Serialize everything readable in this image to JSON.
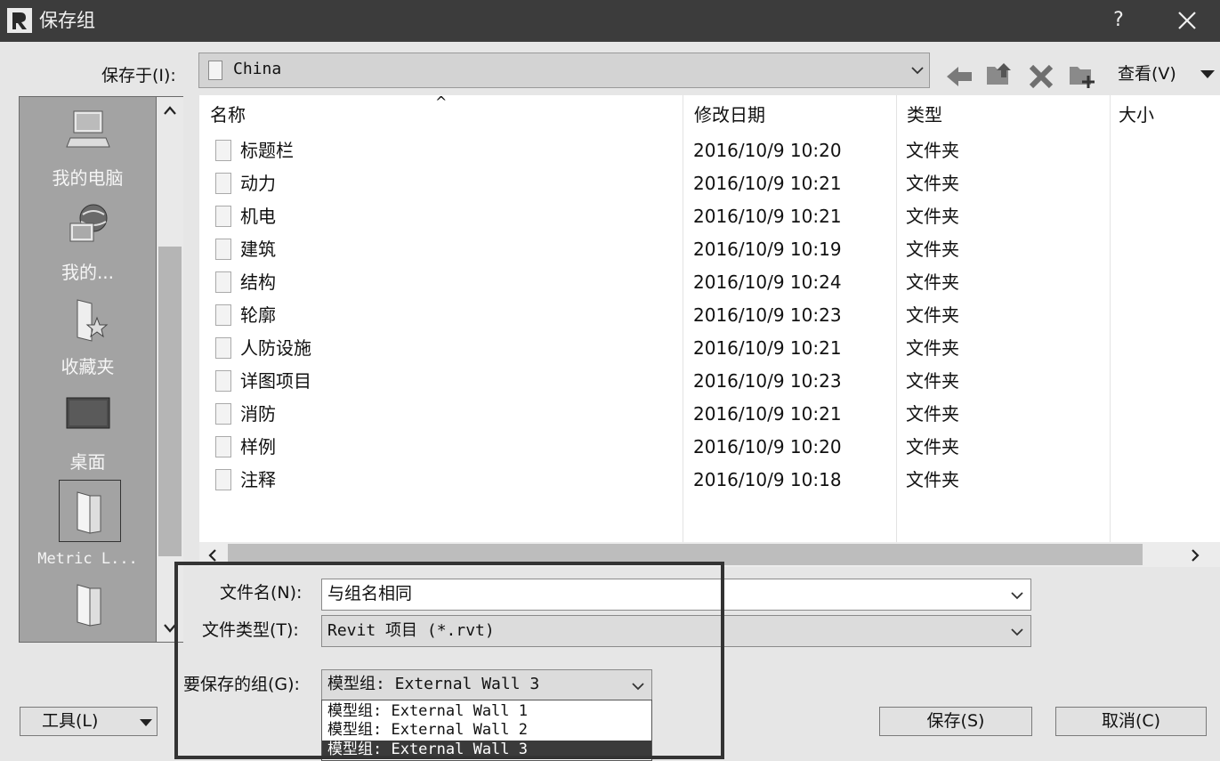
{
  "window": {
    "title": "保存组",
    "help_label": "?",
    "close_label": "Close"
  },
  "toolbar": {
    "save_in_label": "保存于(I):",
    "save_in_value": "China",
    "view_label": "查看(V)"
  },
  "places": [
    {
      "label": "我的电脑",
      "icon": "computer-icon"
    },
    {
      "label": "我的...",
      "icon": "network-globe-icon"
    },
    {
      "label": "收藏夹",
      "icon": "favorites-star-folder-icon"
    },
    {
      "label": "桌面",
      "icon": "desktop-monitor-icon"
    },
    {
      "label": "Metric L...",
      "icon": "folder-icon"
    },
    {
      "label": "",
      "icon": "folder-icon"
    }
  ],
  "file_list": {
    "columns": [
      "名称",
      "修改日期",
      "类型",
      "大小"
    ],
    "sort_indicator": "^",
    "rows": [
      {
        "name": "标题栏",
        "date": "2016/10/9 10:20",
        "type": "文件夹"
      },
      {
        "name": "动力",
        "date": "2016/10/9 10:21",
        "type": "文件夹"
      },
      {
        "name": "机电",
        "date": "2016/10/9 10:21",
        "type": "文件夹"
      },
      {
        "name": "建筑",
        "date": "2016/10/9 10:19",
        "type": "文件夹"
      },
      {
        "name": "结构",
        "date": "2016/10/9 10:24",
        "type": "文件夹"
      },
      {
        "name": "轮廓",
        "date": "2016/10/9 10:23",
        "type": "文件夹"
      },
      {
        "name": "人防设施",
        "date": "2016/10/9 10:21",
        "type": "文件夹"
      },
      {
        "name": "详图项目",
        "date": "2016/10/9 10:23",
        "type": "文件夹"
      },
      {
        "name": "消防",
        "date": "2016/10/9 10:21",
        "type": "文件夹"
      },
      {
        "name": "样例",
        "date": "2016/10/9 10:20",
        "type": "文件夹"
      },
      {
        "name": "注释",
        "date": "2016/10/9 10:18",
        "type": "文件夹"
      }
    ]
  },
  "form": {
    "filename_label": "文件名(N):",
    "filename_value": "与组名相同",
    "filetype_label": "文件类型(T):",
    "filetype_value": "Revit 项目 (*.rvt)",
    "group_label": "要保存的组(G):",
    "group_value": "模型组: External Wall 3",
    "group_options": [
      "模型组: External Wall 1",
      "模型组: External Wall 2",
      "模型组: External Wall 3"
    ],
    "group_selected_index": 2
  },
  "buttons": {
    "tools_label": "工具(L)",
    "save_label": "保存(S)",
    "cancel_label": "取消(C)"
  },
  "colors": {
    "titlebar": "#3c3c3c",
    "places_bg": "#a3a3a3",
    "selected_option": "#3a3a3a",
    "highlight_frame": "#333333"
  }
}
